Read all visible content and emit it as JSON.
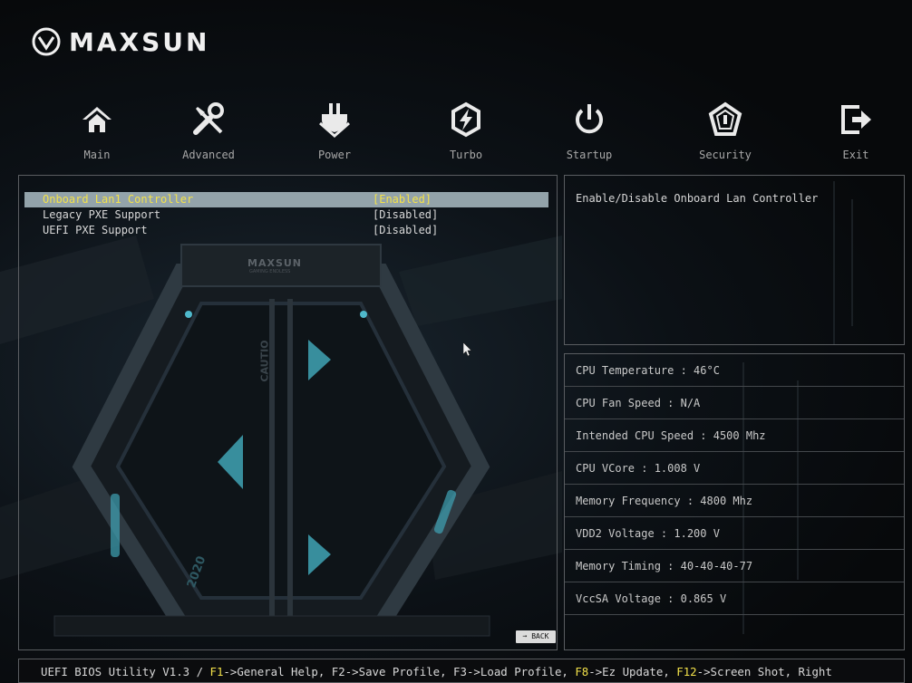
{
  "brand": {
    "name": "MAXSUN",
    "art_text": "MAXSUN",
    "art_subtext": "GAMING ENDLESS",
    "caution": "CAUTIO",
    "year": "2020"
  },
  "nav": {
    "tabs": [
      {
        "label": "Main",
        "icon": "home-icon"
      },
      {
        "label": "Advanced",
        "icon": "tools-icon"
      },
      {
        "label": "Power",
        "icon": "power-plug-icon"
      },
      {
        "label": "Turbo",
        "icon": "turbo-lightning-icon"
      },
      {
        "label": "Startup",
        "icon": "power-button-icon"
      },
      {
        "label": "Security",
        "icon": "security-shield-icon"
      },
      {
        "label": "Exit",
        "icon": "exit-icon"
      }
    ]
  },
  "settings": [
    {
      "name": "Onboard Lan1 Controller",
      "value": "[Enabled]",
      "selected": true
    },
    {
      "name": "Legacy PXE Support",
      "value": "[Disabled]",
      "selected": false
    },
    {
      "name": "UEFI PXE Support",
      "value": "[Disabled]",
      "selected": false
    }
  ],
  "help": "Enable/Disable Onboard Lan Controller",
  "info": [
    "CPU Temperature : 46°C",
    "CPU Fan Speed : N/A",
    "Intended CPU Speed : 4500 Mhz",
    "CPU VCore : 1.008 V",
    "Memory Frequency : 4800 Mhz",
    "VDD2 Voltage : 1.200 V",
    "Memory Timing : 40-40-40-77",
    "VccSA Voltage : 0.865 V"
  ],
  "back_label": "BACK",
  "footer": {
    "prefix": "UEFI BIOS Utility V1.3 / ",
    "f1": "F1",
    "f1_text": "->General Help, F2->Save Profile, F3->Load Profile, ",
    "f8": "F8",
    "f8_text": "->Ez Update, ",
    "f12": "F12",
    "f12_text": "->Screen Shot, Right"
  },
  "colors": {
    "highlight_bg": "#93a3aa",
    "highlight_text": "#f3e24a",
    "border": "#5a5d61",
    "accent_teal": "#3fa3b5"
  }
}
